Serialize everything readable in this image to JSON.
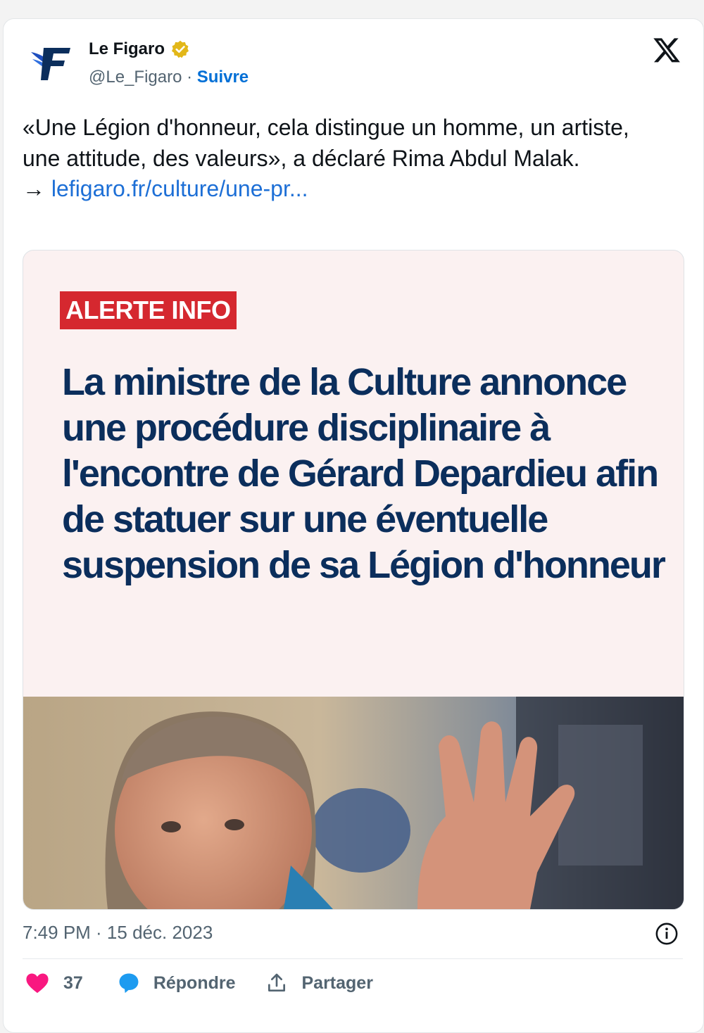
{
  "account": {
    "display_name": "Le Figaro",
    "handle": "@Le_Figaro",
    "separator": "·",
    "follow_label": "Suivre"
  },
  "tweet": {
    "text": "«Une Légion d'honneur, cela distingue un homme, un artiste, une attitude, des valeurs», a déclaré Rima Abdul Malak.",
    "link_arrow": "→",
    "link_text": "lefigaro.fr/culture/une-pr..."
  },
  "media": {
    "badge": "ALERTE INFO",
    "headline": "La ministre de la Culture annonce une procédure disciplinaire à l'encontre de Gérard Depardieu afin de statuer sur une éventuelle suspension de sa Légion d'honneur"
  },
  "meta": {
    "time": "7:49 PM · 15 déc. 2023"
  },
  "actions": {
    "like_count": "37",
    "reply_label": "Répondre",
    "share_label": "Partager"
  },
  "colors": {
    "accent_link": "#1d6fd6",
    "follow": "#006fd6",
    "alert_red": "#d5282f",
    "headline_navy": "#0b2e5c",
    "like_pink": "#f91880",
    "verified_gold": "#e2b719"
  },
  "icons": {
    "logo": "le-figaro-logo",
    "verified": "verified-badge-icon",
    "platform": "x-logo-icon",
    "info": "info-icon",
    "like": "heart-icon",
    "reply": "reply-bubble-icon",
    "share": "share-upload-icon"
  }
}
